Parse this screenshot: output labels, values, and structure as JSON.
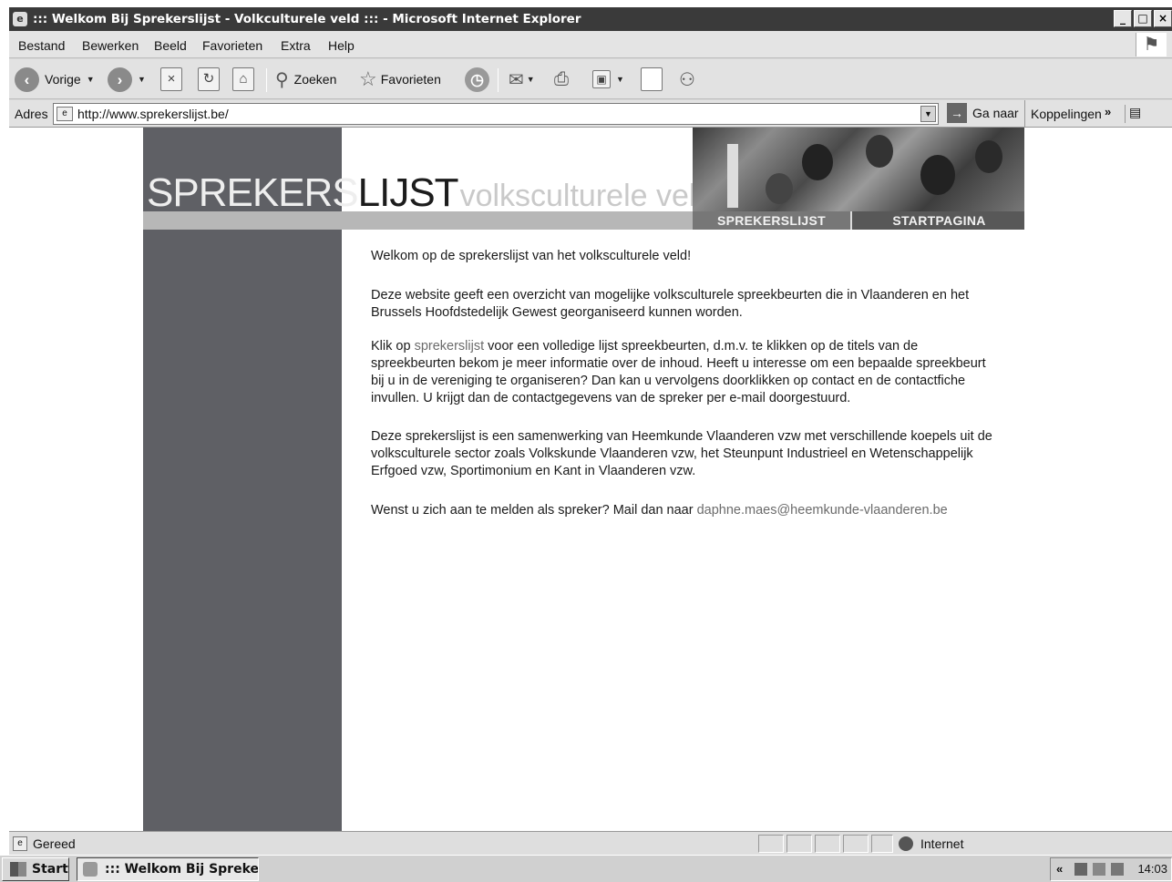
{
  "window": {
    "title": "::: Welkom Bij Sprekerslijst - Volkculturele veld ::: - Microsoft Internet Explorer",
    "controls": [
      "_",
      "□",
      "×"
    ]
  },
  "menu": {
    "items": [
      "Bestand",
      "Bewerken",
      "Beeld",
      "Favorieten",
      "Extra",
      "Help"
    ]
  },
  "toolbar": {
    "back_label": "Vorige",
    "search_label": "Zoeken",
    "favorites_label": "Favorieten"
  },
  "address": {
    "label": "Adres",
    "url": "http://www.sprekerslijst.be/",
    "go_label": "Ga naar",
    "links_label": "Koppelingen"
  },
  "page": {
    "logo": {
      "part1": "SPREKERS",
      "part2": "LIJST",
      "part3": "volksculturele veld"
    },
    "nav": {
      "sprekerslijst": "SPREKERSLIJST",
      "startpagina": "STARTPAGINA"
    },
    "content": {
      "p1": "Welkom op de sprekerslijst van het volksculturele veld!",
      "p2": "Deze website geeft een overzicht van mogelijke volksculturele spreekbeurten die in Vlaanderen en het Brussels Hoofdstedelijk Gewest georganiseerd kunnen worden.",
      "p3_before": "Klik op ",
      "p3_link": "sprekerslijst",
      "p3_after": " voor een volledige lijst spreekbeurten, d.m.v. te klikken op de titels van de spreekbeurten bekom je meer informatie over de inhoud. Heeft u interesse om een bepaalde spreekbeurt bij u in de vereniging te organiseren? Dan kan u vervolgens doorklikken op contact en de contactfiche invullen. U krijgt dan de contactgegevens van de spreker per e-mail doorgestuurd.",
      "p4": "Deze sprekerslijst is een samenwerking van Heemkunde Vlaanderen vzw met verschillende koepels uit de volksculturele sector zoals Volkskunde Vlaanderen vzw, het Steunpunt Industrieel en Wetenschappelijk Erfgoed vzw, Sportimonium en Kant in Vlaanderen vzw.",
      "p5_before": "Wenst u zich aan te melden als spreker? Mail dan naar ",
      "p5_email": "daphne.maes@heemkunde-vlaanderen.be"
    }
  },
  "status": {
    "text": "Gereed",
    "zone": "Internet"
  },
  "taskbar": {
    "start_label": "Start",
    "task_label": "::: Welkom Bij Spreker...",
    "tray_chevron": "«",
    "clock": "14:03"
  }
}
